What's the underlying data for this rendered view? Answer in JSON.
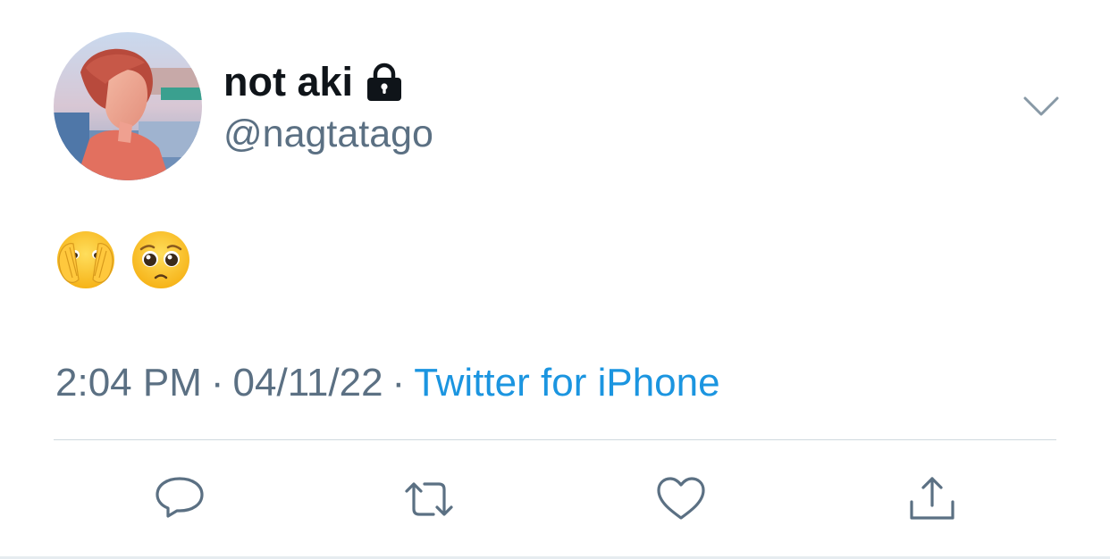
{
  "tweet": {
    "display_name": "not aki",
    "handle": "@nagtatago",
    "body_emojis": [
      "face-with-open-eyes-and-hand-over-mouth",
      "pleading-face"
    ],
    "time": "2:04 PM",
    "date": "04/11/22",
    "separator": "·",
    "source": "Twitter for iPhone",
    "protected_icon": "lock-icon",
    "menu_icon": "chevron-down-icon"
  },
  "actions": [
    {
      "name": "reply",
      "icon": "speech-bubble-icon"
    },
    {
      "name": "retweet",
      "icon": "retweet-arrows-icon"
    },
    {
      "name": "like",
      "icon": "heart-icon"
    },
    {
      "name": "share",
      "icon": "share-upload-icon"
    }
  ],
  "colors": {
    "text_primary": "#0f1419",
    "text_secondary": "#5b7083",
    "link": "#1b95e0",
    "divider": "#cfd9de"
  }
}
